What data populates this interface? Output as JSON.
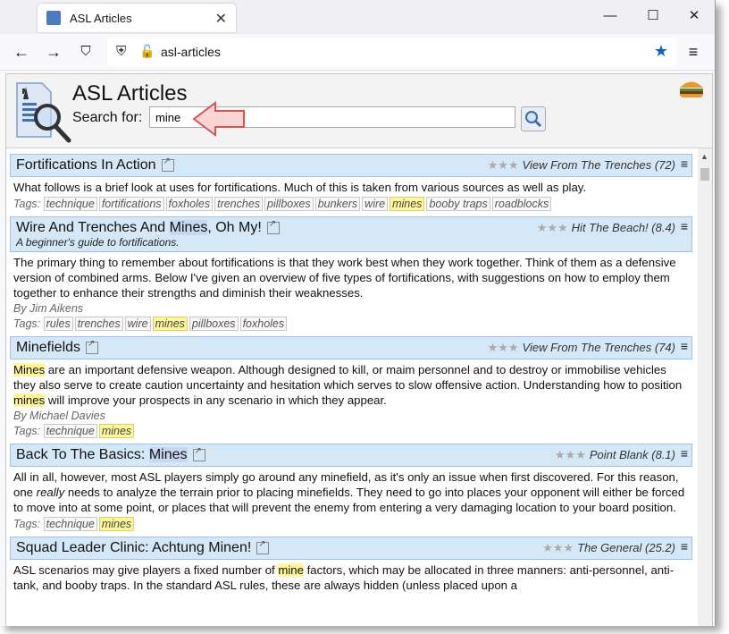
{
  "browser": {
    "tab_title": "ASL Articles",
    "url": "asl-articles",
    "win_minimize": "—",
    "win_maximize": "☐",
    "win_close": "✕",
    "tab_close": "✕",
    "nav_back": "←",
    "nav_forward": "→",
    "menu": "≡"
  },
  "header": {
    "title": "ASL Articles",
    "search_label": "Search for:",
    "search_value": "mine"
  },
  "articles": [
    {
      "title_parts": [
        "Fortifications In Action",
        "",
        ""
      ],
      "subtitle": "",
      "source": "View From The Trenches (72)",
      "body": "What follows is a brief look at uses for fortifications. Much of this is taken from various sources as well as play.",
      "byline": "",
      "tags_label": "Tags:",
      "tags": [
        "technique",
        "fortifications",
        "foxholes",
        "trenches",
        "pillboxes",
        "bunkers",
        "wire",
        "mines",
        "booby traps",
        "roadblocks"
      ]
    },
    {
      "title_parts": [
        "Wire And Trenches And ",
        "Mines",
        ", Oh My!"
      ],
      "subtitle": "A beginner's guide to fortifications.",
      "source": "Hit The Beach! (8.4)",
      "body": "The primary thing to remember about fortifications is that they work best when they work together. Think of them as a defensive version of combined arms. Below I've given an overview of five types of fortifications, with suggestions on how to employ them together to enhance their strengths and diminish their weaknesses.",
      "byline": "By Jim Aikens",
      "tags_label": "Tags:",
      "tags": [
        "rules",
        "trenches",
        "wire",
        "mines",
        "pillboxes",
        "foxholes"
      ]
    },
    {
      "title_parts": [
        "Minefields",
        "",
        ""
      ],
      "subtitle": "",
      "source": "View From The Trenches (74)",
      "body_parts": [
        "Mines",
        " are an important defensive weapon. Although designed to kill, or maim personnel and to destroy or immobilise vehicles they also serve to create caution uncertainty and hesitation which serves to slow offensive action. Understanding how to position ",
        "mines",
        " will improve your prospects in any scenario in which they appear."
      ],
      "byline": "By Michael Davies",
      "tags_label": "Tags:",
      "tags": [
        "technique",
        "mines"
      ]
    },
    {
      "title_parts": [
        "Back To The Basics: ",
        "Mines",
        ""
      ],
      "subtitle": "",
      "source": "Point Blank (8.1)",
      "body_parts": [
        "All in all, however, most ASL players simply go around any minefield, as it's only an issue when first discovered. For this reason, one ",
        "really",
        " needs to analyze the terrain prior to placing minefields. They need to go into places your opponent will either be forced to move into at some point, or places that will prevent the enemy from entering a very damaging location to your board position."
      ],
      "byline": "",
      "tags_label": "Tags:",
      "tags": [
        "technique",
        "mines"
      ]
    },
    {
      "title_parts": [
        "Squad Leader Clinic: Achtung Minen!",
        "",
        ""
      ],
      "subtitle": "",
      "source": "The General (25.2)",
      "body_parts": [
        "ASL scenarios may give players a fixed number of ",
        "mine",
        " factors, which may be allocated in three manners: anti-personnel, anti-tank, and booby traps. In the standard ASL rules, these are always hidden (unless placed upon a"
      ],
      "byline": "",
      "tags_label": "",
      "tags": []
    }
  ],
  "stars": "★★★",
  "article_menu": "≡"
}
